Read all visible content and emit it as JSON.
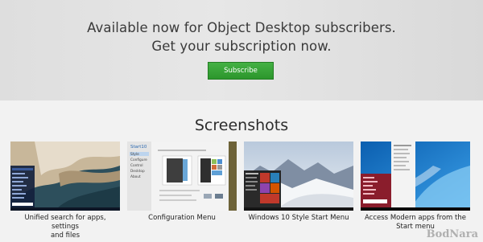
{
  "hero": {
    "line1": "Available now for Object Desktop subscribers.",
    "line2": "Get your subscription now.",
    "button_label": "Subscribe"
  },
  "screenshots": {
    "title": "Screenshots",
    "items": [
      {
        "caption_line1": "Unified search for apps, settings",
        "caption_line2": "and files"
      },
      {
        "caption_line1": "Configuration Menu",
        "caption_line2": ""
      },
      {
        "caption_line1": "Windows 10 Style Start Menu",
        "caption_line2": ""
      },
      {
        "caption_line1": "Access Modern apps from the",
        "caption_line2": "Start menu"
      }
    ]
  },
  "config_menu": {
    "logo": "Start10",
    "items": [
      "Style",
      "Configure",
      "Control",
      "Desktop",
      "About"
    ]
  },
  "watermark": "BodNara",
  "colors": {
    "accent_green": "#2f9a2f",
    "hero_bg": "#e3e3e3",
    "page_bg": "#f2f2f2"
  }
}
